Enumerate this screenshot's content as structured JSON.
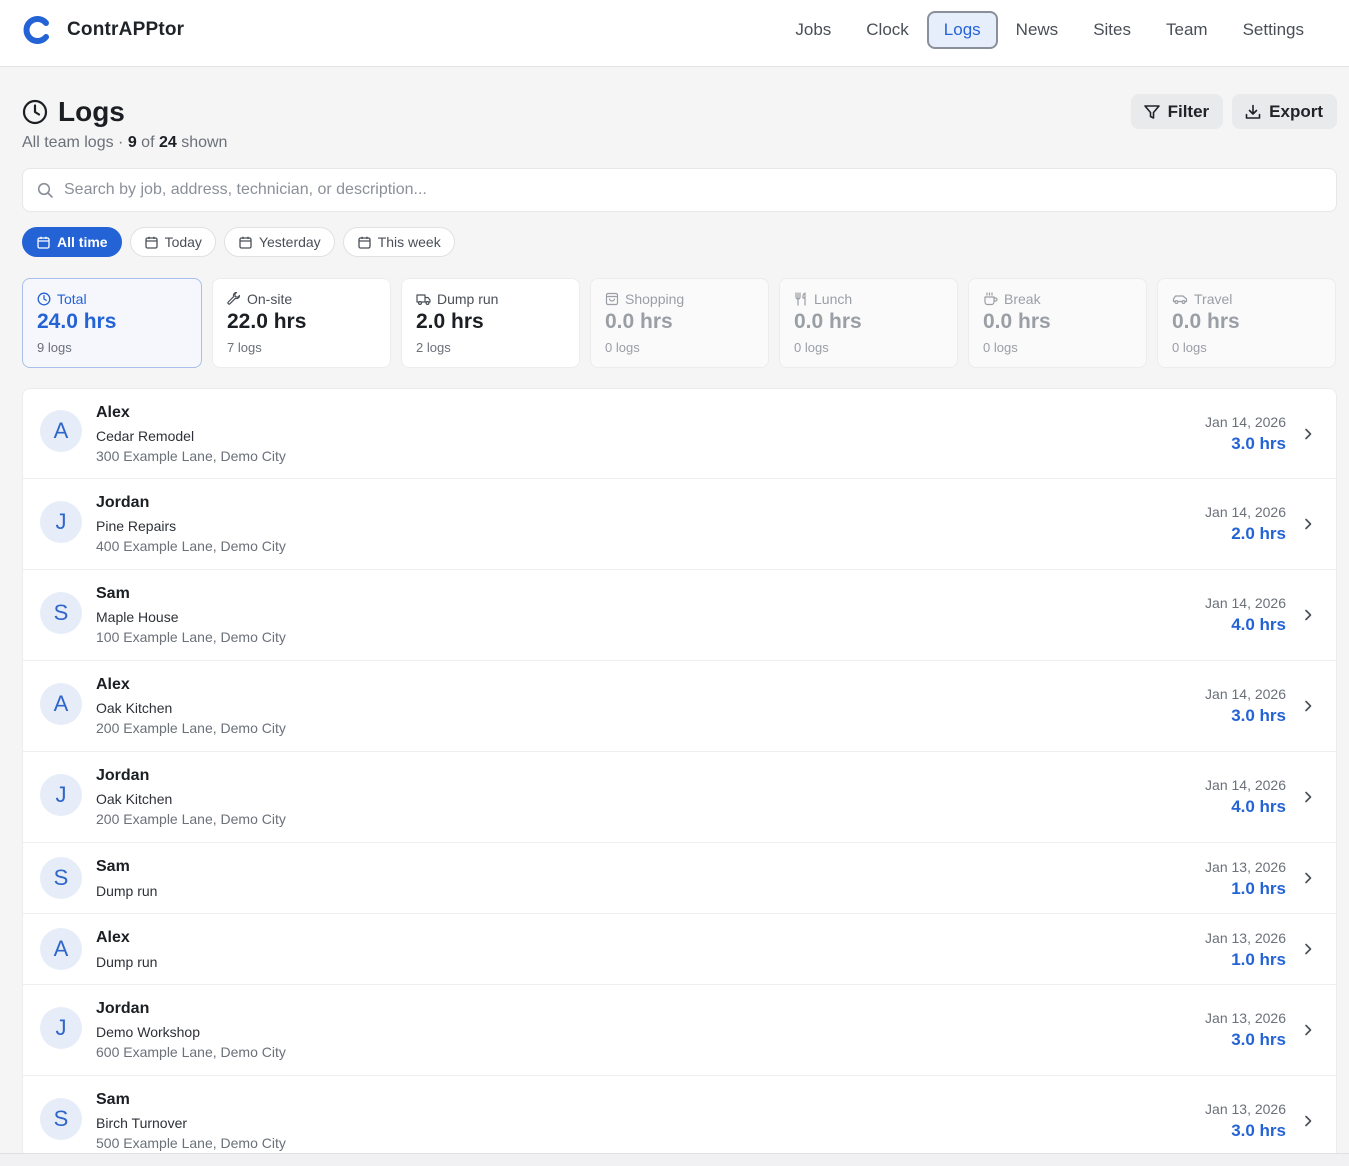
{
  "app": {
    "name": "ContrAPPtor",
    "accent": "#2463d6"
  },
  "nav": {
    "items": [
      {
        "label": "Jobs"
      },
      {
        "label": "Clock"
      },
      {
        "label": "Logs",
        "active": true
      },
      {
        "label": "News"
      },
      {
        "label": "Sites"
      },
      {
        "label": "Team"
      },
      {
        "label": "Settings"
      }
    ]
  },
  "header": {
    "title": "Logs",
    "subtitle_prefix": "All team logs · ",
    "shown": "9",
    "of_text": " of ",
    "total": "24",
    "shown_suffix": " shown",
    "filter_label": "Filter",
    "export_label": "Export"
  },
  "search": {
    "placeholder": "Search by job, address, technician, or description..."
  },
  "date_filters": [
    {
      "label": "All time",
      "active": true
    },
    {
      "label": "Today"
    },
    {
      "label": "Yesterday"
    },
    {
      "label": "This week"
    }
  ],
  "stats": [
    {
      "label": "Total",
      "value": "24.0 hrs",
      "count": "9 logs",
      "icon": "clock-icon",
      "state": "active"
    },
    {
      "label": "On-site",
      "value": "22.0 hrs",
      "count": "7 logs",
      "icon": "wrench-icon",
      "state": "normal"
    },
    {
      "label": "Dump run",
      "value": "2.0 hrs",
      "count": "2 logs",
      "icon": "truck-icon",
      "state": "normal"
    },
    {
      "label": "Shopping",
      "value": "0.0 hrs",
      "count": "0 logs",
      "icon": "shopping-bag-icon",
      "state": "dim"
    },
    {
      "label": "Lunch",
      "value": "0.0 hrs",
      "count": "0 logs",
      "icon": "utensils-icon",
      "state": "dim"
    },
    {
      "label": "Break",
      "value": "0.0 hrs",
      "count": "0 logs",
      "icon": "coffee-icon",
      "state": "dim"
    },
    {
      "label": "Travel",
      "value": "0.0 hrs",
      "count": "0 logs",
      "icon": "car-icon",
      "state": "dim"
    }
  ],
  "logs": [
    {
      "initial": "A",
      "name": "Alex",
      "job": "Cedar Remodel",
      "address": "300 Example Lane, Demo City",
      "date": "Jan 14, 2026",
      "hours": "3.0 hrs"
    },
    {
      "initial": "J",
      "name": "Jordan",
      "job": "Pine Repairs",
      "address": "400 Example Lane, Demo City",
      "date": "Jan 14, 2026",
      "hours": "2.0 hrs"
    },
    {
      "initial": "S",
      "name": "Sam",
      "job": "Maple House",
      "address": "100 Example Lane, Demo City",
      "date": "Jan 14, 2026",
      "hours": "4.0 hrs"
    },
    {
      "initial": "A",
      "name": "Alex",
      "job": "Oak Kitchen",
      "address": "200 Example Lane, Demo City",
      "date": "Jan 14, 2026",
      "hours": "3.0 hrs"
    },
    {
      "initial": "J",
      "name": "Jordan",
      "job": "Oak Kitchen",
      "address": "200 Example Lane, Demo City",
      "date": "Jan 14, 2026",
      "hours": "4.0 hrs"
    },
    {
      "initial": "S",
      "name": "Sam",
      "job": "Dump run",
      "address": "",
      "date": "Jan 13, 2026",
      "hours": "1.0 hrs"
    },
    {
      "initial": "A",
      "name": "Alex",
      "job": "Dump run",
      "address": "",
      "date": "Jan 13, 2026",
      "hours": "1.0 hrs"
    },
    {
      "initial": "J",
      "name": "Jordan",
      "job": "Demo Workshop",
      "address": "600 Example Lane, Demo City",
      "date": "Jan 13, 2026",
      "hours": "3.0 hrs"
    },
    {
      "initial": "S",
      "name": "Sam",
      "job": "Birch Turnover",
      "address": "500 Example Lane, Demo City",
      "date": "Jan 13, 2026",
      "hours": "3.0 hrs"
    }
  ]
}
